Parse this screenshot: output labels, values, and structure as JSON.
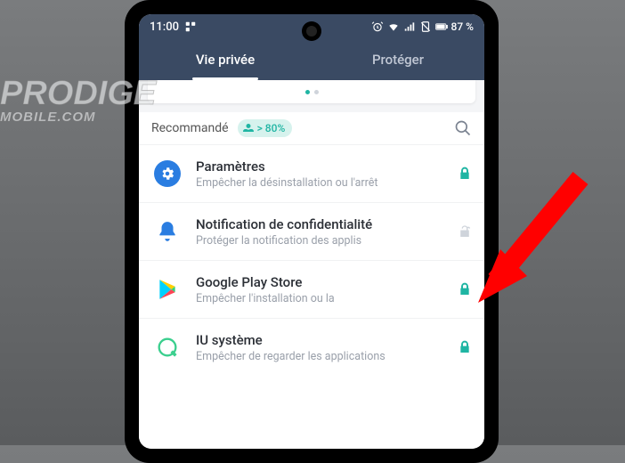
{
  "statusbar": {
    "time": "11:00",
    "battery_text": "87 %"
  },
  "tabs": {
    "privacy": "Vie privée",
    "protect": "Protéger"
  },
  "section": {
    "recommended": "Recommandé",
    "badge": "> 80%"
  },
  "items": [
    {
      "title": "Paramètres",
      "sub": "Empêcher la désinstallation ou l'arrêt",
      "locked": true
    },
    {
      "title": "Notification de confidentialité",
      "sub": "Protéger la notification des applis",
      "locked": false
    },
    {
      "title": "Google Play Store",
      "sub": "Empêcher l'installation ou la",
      "locked": true
    },
    {
      "title": "IU système",
      "sub": "Empêcher de regarder les applications",
      "locked": true
    }
  ],
  "watermark": {
    "line1": "PRODIGE",
    "line2": "MOBILE.COM"
  }
}
